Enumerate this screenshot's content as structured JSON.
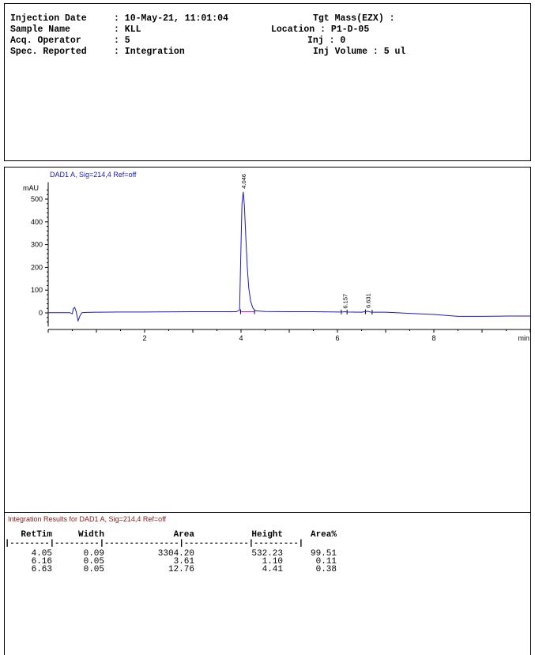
{
  "header": {
    "fields": [
      {
        "label": "Injection Date",
        "value": ": 10-May-21, 11:01:04"
      },
      {
        "label": "Sample Name",
        "value": ": KLL"
      },
      {
        "label": "Acq. Operator",
        "value": ": 5"
      },
      {
        "label": "Spec. Reported",
        "value": ": Integration"
      }
    ],
    "right_fields": [
      "Tgt Mass(EZX) :",
      "Location : P1-D-05",
      "Inj : 0",
      "Inj Volume : 5 ul"
    ]
  },
  "chart_data": {
    "type": "line",
    "title": "DAD1 A, Sig=214,4 Ref=off",
    "ylabel": "mAU",
    "xlabel": "min",
    "xlim": [
      0,
      10
    ],
    "ylim": [
      -60,
      560
    ],
    "xticks": [
      2,
      4,
      6,
      8
    ],
    "yticks": [
      0,
      100,
      200,
      300,
      400,
      500
    ],
    "line_color": "#1a1acc",
    "baseline_color": "#d020d0",
    "series": [
      {
        "x": [
          0.0,
          0.45,
          0.5,
          0.52,
          0.55,
          0.58,
          0.62,
          0.66,
          0.7,
          0.8,
          1.0,
          1.5,
          2.0,
          3.0,
          3.9,
          3.97,
          4.0,
          4.02,
          4.046,
          4.07,
          4.1,
          4.13,
          4.16,
          4.2,
          4.25,
          4.3,
          4.5,
          5.0,
          5.5,
          6.0,
          6.1,
          6.157,
          6.2,
          6.5,
          6.631,
          6.7,
          7.0,
          7.5,
          8.0,
          8.5,
          9.0,
          9.5,
          10.0
        ],
        "y": [
          1,
          1,
          -4,
          18,
          24,
          6,
          -35,
          -12,
          1,
          2,
          3,
          4,
          4,
          5,
          5,
          12,
          300,
          480,
          532,
          470,
          330,
          200,
          110,
          50,
          20,
          9,
          6,
          5,
          5,
          4,
          4,
          5,
          4,
          3,
          7,
          3,
          3,
          -2,
          -7,
          -15,
          -15,
          -14,
          -14
        ]
      }
    ],
    "peak_labels": [
      {
        "rt": 4.046,
        "text": "4.046",
        "height": 532
      },
      {
        "rt": 6.157,
        "text": "6.157",
        "height": 5
      },
      {
        "rt": 6.631,
        "text": "6.631",
        "height": 7
      }
    ]
  },
  "results": {
    "title": "Integration Results for DAD1 A, Sig=214,4 Ref=off",
    "columns": [
      "RetTim",
      "Width",
      "Area",
      "Height",
      "Area%"
    ],
    "separator": "|--------|---------|---------------|-------------|---------|",
    "rows": [
      [
        "4.05",
        "0.09",
        "3304.20",
        "532.23",
        "99.51"
      ],
      [
        "6.16",
        "0.05",
        "3.61",
        "1.10",
        "0.11"
      ],
      [
        "6.63",
        "0.05",
        "12.76",
        "4.41",
        "0.38"
      ]
    ]
  }
}
